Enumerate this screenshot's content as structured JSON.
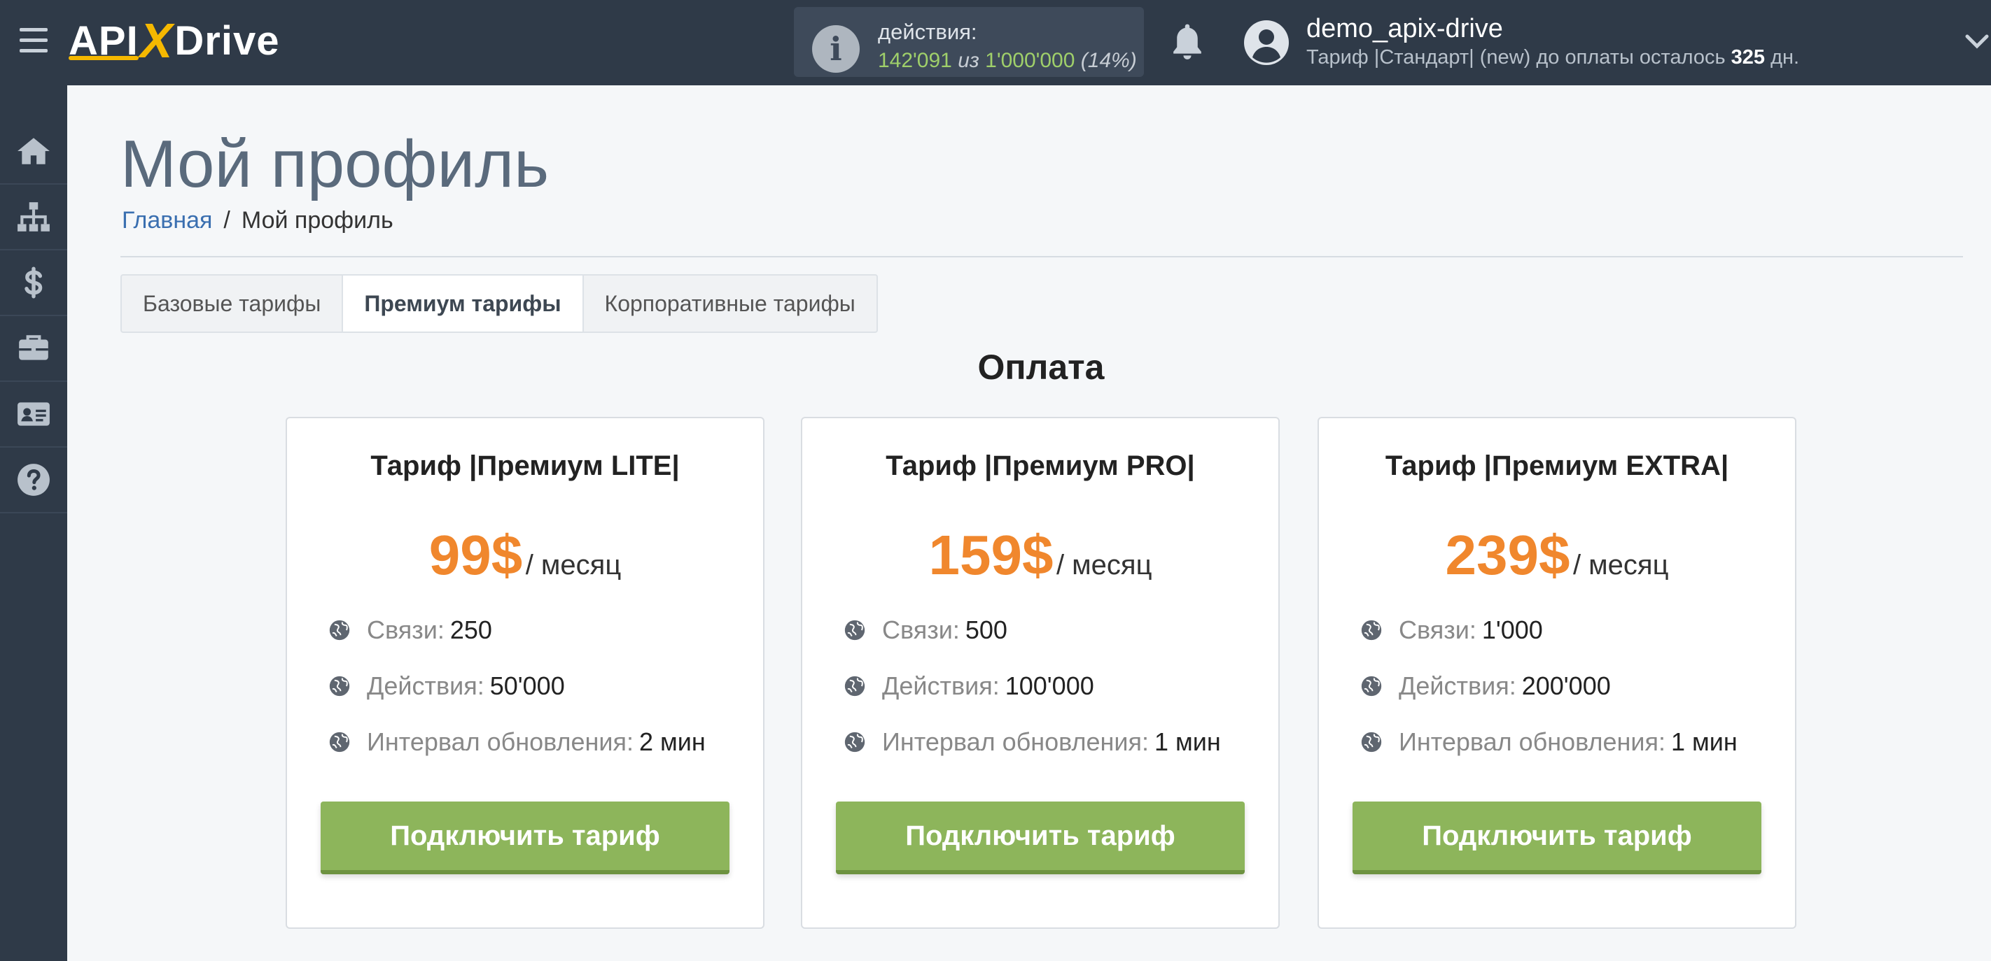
{
  "header": {
    "logo": {
      "api": "API",
      "x": "X",
      "drive": "Drive"
    },
    "actions_label": "действия:",
    "actions_used": "142'091",
    "actions_sep": "из",
    "actions_total": "1'000'000",
    "actions_pct": "(14%)",
    "username": "demo_apix-drive",
    "plan_prefix": "Тариф |Стандарт| (new) до оплаты осталось",
    "plan_days": "325",
    "plan_suffix": "дн."
  },
  "sidebar": {
    "items": [
      {
        "icon": "home-icon"
      },
      {
        "icon": "sitemap-icon"
      },
      {
        "icon": "dollar-icon"
      },
      {
        "icon": "briefcase-icon"
      },
      {
        "icon": "id-card-icon"
      },
      {
        "icon": "help-icon"
      }
    ]
  },
  "page": {
    "title": "Мой профиль",
    "breadcrumb": {
      "home": "Главная",
      "sep": "/",
      "current": "Мой профиль"
    }
  },
  "tabs": [
    {
      "label": "Базовые тарифы",
      "active": false
    },
    {
      "label": "Премиум тарифы",
      "active": true
    },
    {
      "label": "Корпоративные тарифы",
      "active": false
    }
  ],
  "section_title": "Оплата",
  "plans": [
    {
      "title": "Тариф |Премиум LITE|",
      "price": "99$",
      "period": "/ месяц",
      "features": [
        {
          "label": "Связи:",
          "value": "250"
        },
        {
          "label": "Действия:",
          "value": "50'000"
        },
        {
          "label": "Интервал обновления:",
          "value": "2 мин"
        }
      ],
      "button": "Подключить тариф"
    },
    {
      "title": "Тариф |Премиум PRO|",
      "price": "159$",
      "period": "/ месяц",
      "features": [
        {
          "label": "Связи:",
          "value": "500"
        },
        {
          "label": "Действия:",
          "value": "100'000"
        },
        {
          "label": "Интервал обновления:",
          "value": "1 мин"
        }
      ],
      "button": "Подключить тариф"
    },
    {
      "title": "Тариф |Премиум EXTRA|",
      "price": "239$",
      "period": "/ месяц",
      "features": [
        {
          "label": "Связи:",
          "value": "1'000"
        },
        {
          "label": "Действия:",
          "value": "200'000"
        },
        {
          "label": "Интервал обновления:",
          "value": "1 мин"
        }
      ],
      "button": "Подключить тариф"
    }
  ],
  "colors": {
    "topbar": "#2f3a48",
    "price": "#f0872d",
    "button": "#8db55b",
    "link": "#3a6fb0",
    "actions_value": "#9fcf6a"
  }
}
